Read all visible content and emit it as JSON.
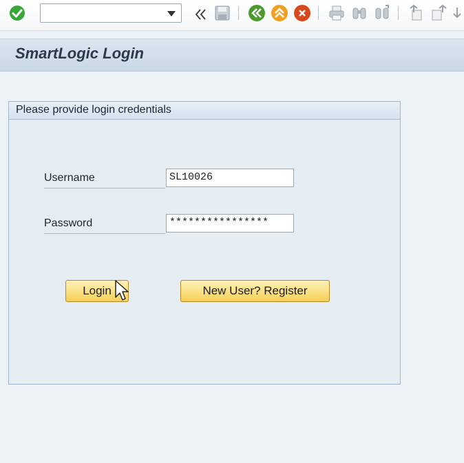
{
  "toolbar": {
    "command_field": {
      "value": ""
    },
    "icons": [
      "enter-check-icon",
      "command-dropdown-icon",
      "collapse-toolbar-icon",
      "save-icon",
      "back-icon",
      "exit-icon",
      "cancel-icon",
      "print-icon",
      "find-icon",
      "find-next-icon",
      "first-page-icon",
      "previous-page-icon",
      "next-page-icon"
    ]
  },
  "page": {
    "title": "SmartLogic Login"
  },
  "form": {
    "group_title": "Please provide login credentials",
    "username_label": "Username",
    "username_value": "SL10026",
    "password_label": "Password",
    "password_value": "****************",
    "login_label": "Login",
    "register_label": "New User? Register"
  },
  "colors": {
    "background": "#edf2f6",
    "button": "#f6d057",
    "enter_green": "#3aa63a",
    "back_green": "#4b9a2e",
    "exit_orange": "#f0a020",
    "cancel_red": "#d9481b"
  }
}
